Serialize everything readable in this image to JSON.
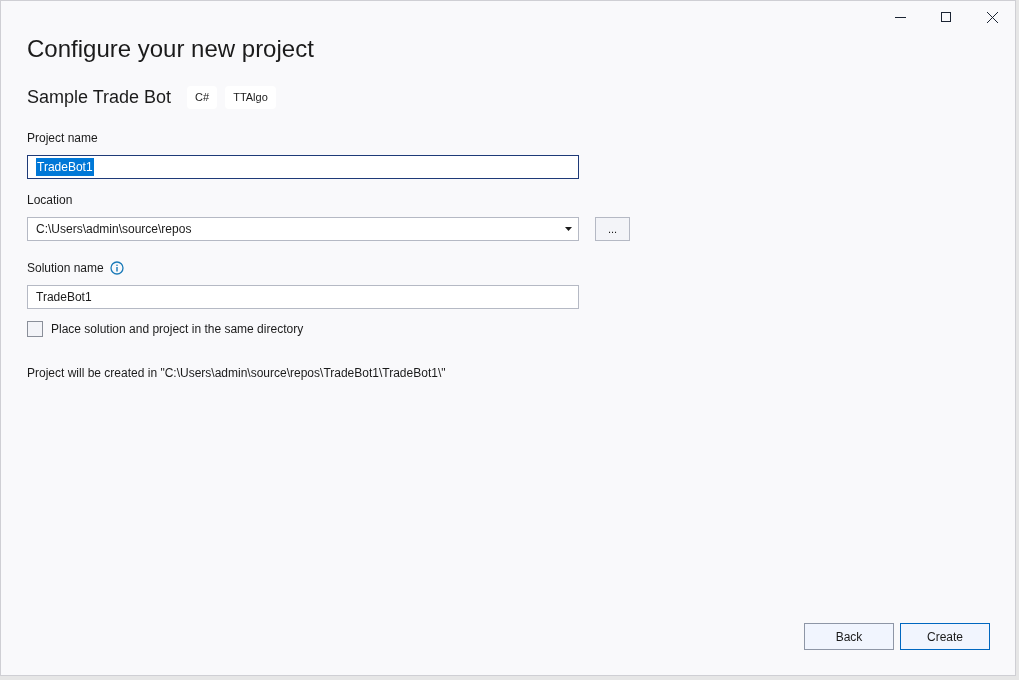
{
  "window": {
    "title": "Configure your new project"
  },
  "template": {
    "name": "Sample Trade Bot",
    "tags": [
      "C#",
      "TTAlgo"
    ]
  },
  "project_name": {
    "label": "Project name",
    "value": "TradeBot1",
    "text_selected": true
  },
  "location": {
    "label": "Location",
    "value": "C:\\Users\\admin\\source\\repos",
    "browse_button": "..."
  },
  "solution_name": {
    "label": "Solution name",
    "value": "TradeBot1"
  },
  "same_directory": {
    "label": "Place solution and project in the same directory",
    "checked": false
  },
  "summary": "Project will be created in \"C:\\Users\\admin\\source\\repos\\TradeBot1\\TradeBot1\\\"",
  "buttons": [
    {
      "label": "Back",
      "kind": "secondary"
    },
    {
      "label": "Create",
      "kind": "primary"
    }
  ]
}
